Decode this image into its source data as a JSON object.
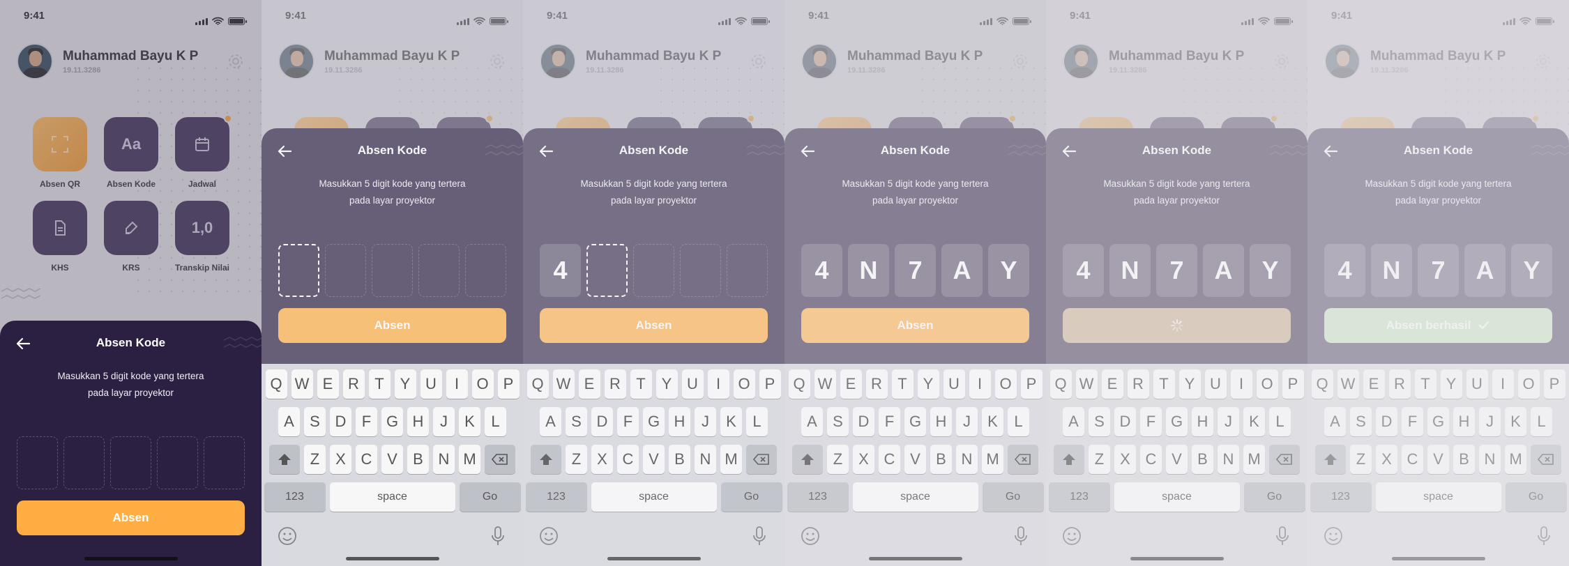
{
  "status_bar": {
    "time": "9:41"
  },
  "profile": {
    "name": "Muhammad Bayu K P",
    "nim": "19.11.3286"
  },
  "menu": [
    {
      "label": "Absen QR",
      "icon": "scan-icon",
      "accent": "orange"
    },
    {
      "label": "Absen Kode",
      "icon": "Aa",
      "accent": "purple"
    },
    {
      "label": "Jadwal",
      "icon": "calendar-icon",
      "accent": "purple",
      "badge": true
    },
    {
      "label": "KHS",
      "icon": "document-icon",
      "accent": "purple"
    },
    {
      "label": "KRS",
      "icon": "edit-icon",
      "accent": "purple"
    },
    {
      "label": "Transkip Nilai",
      "icon": "1,0",
      "accent": "purple"
    }
  ],
  "sheet": {
    "title": "Absen Kode",
    "description_line1": "Masukkan 5 digit kode yang tertera",
    "description_line2": "pada layar proyektor"
  },
  "keyboard": {
    "row1": [
      "Q",
      "W",
      "E",
      "R",
      "T",
      "Y",
      "U",
      "I",
      "O",
      "P"
    ],
    "row2": [
      "A",
      "S",
      "D",
      "F",
      "G",
      "H",
      "J",
      "K",
      "L"
    ],
    "row3": [
      "Z",
      "X",
      "C",
      "V",
      "B",
      "N",
      "M"
    ],
    "numbers_key": "123",
    "space_key": "space",
    "go_key": "Go"
  },
  "colors": {
    "accent_orange": "#ffae44",
    "sheet_purple": "#2c2042",
    "tile_purple": "#3b2d54",
    "success_green": "#bfe6b3",
    "loading_tan": "#c9a98a"
  },
  "frames": [
    {
      "id": "step-1-empty",
      "overlay": 0.0,
      "sheet_top": "low",
      "keyboard": false,
      "codes": [
        "",
        "",
        "",
        "",
        ""
      ],
      "active_box": -1,
      "button_label": "Absen",
      "button_state": "default"
    },
    {
      "id": "step-2-focused",
      "overlay": 0.32,
      "sheet_top": "high",
      "keyboard": true,
      "codes": [
        "",
        "",
        "",
        "",
        ""
      ],
      "active_box": 0,
      "button_label": "Absen",
      "button_state": "default"
    },
    {
      "id": "step-3-typing",
      "overlay": 0.4,
      "sheet_top": "high",
      "keyboard": true,
      "codes": [
        "4",
        "",
        "",
        "",
        ""
      ],
      "active_box": 1,
      "button_label": "Absen",
      "button_state": "default"
    },
    {
      "id": "step-4-filled",
      "overlay": 0.48,
      "sheet_top": "high",
      "keyboard": true,
      "codes": [
        "4",
        "N",
        "7",
        "A",
        "Y"
      ],
      "active_box": -1,
      "button_label": "Absen",
      "button_state": "default"
    },
    {
      "id": "step-5-loading",
      "overlay": 0.56,
      "sheet_top": "high",
      "keyboard": true,
      "codes": [
        "4",
        "N",
        "7",
        "A",
        "Y"
      ],
      "active_box": -1,
      "button_label": "",
      "button_state": "loading"
    },
    {
      "id": "step-6-success",
      "overlay": 0.64,
      "sheet_top": "high",
      "keyboard": true,
      "codes": [
        "4",
        "N",
        "7",
        "A",
        "Y"
      ],
      "active_box": -1,
      "button_label": "Absen berhasil",
      "button_state": "success"
    }
  ]
}
